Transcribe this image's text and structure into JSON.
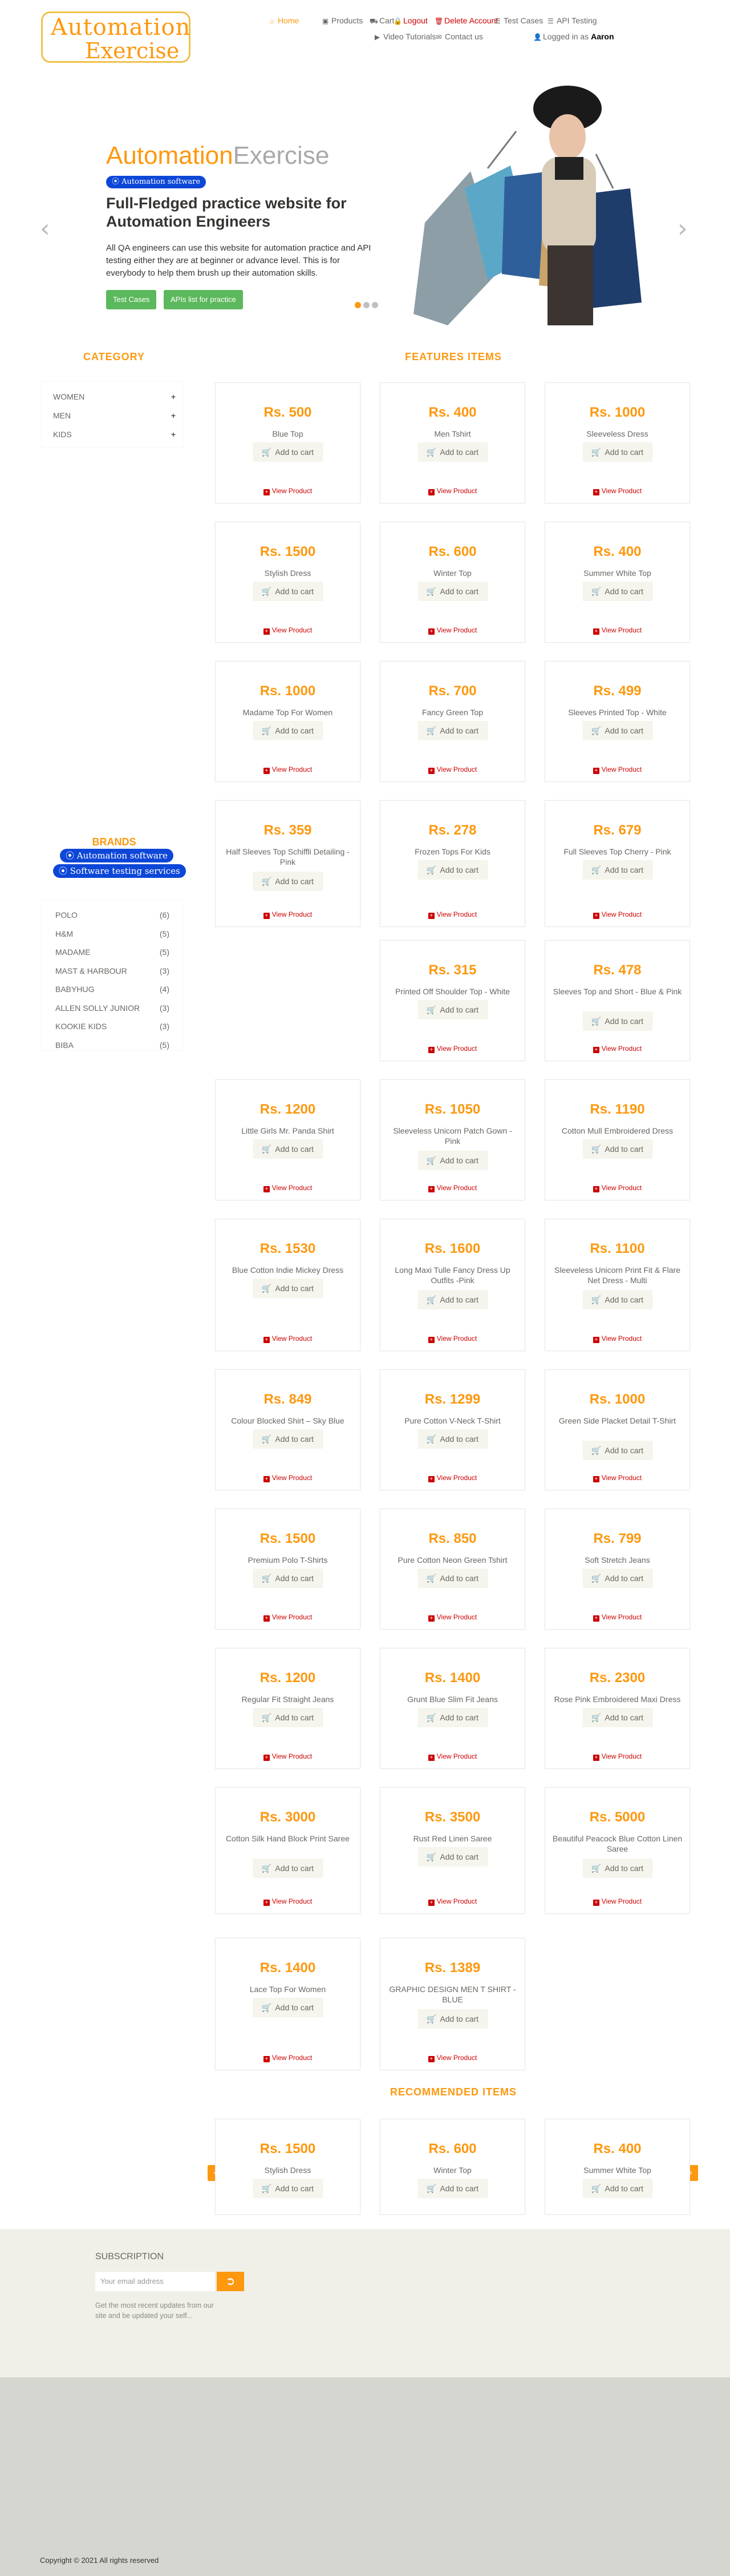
{
  "header": {
    "logo_line1_a": "Automation",
    "logo_line2_a": "Exercise",
    "nav": [
      {
        "label": "Home",
        "icon": "home-icon",
        "glyph": "⌂"
      },
      {
        "label": "Products",
        "icon": "products-icon",
        "glyph": "▣"
      },
      {
        "label": "Cart",
        "icon": "cart-icon",
        "glyph": "⛟"
      },
      {
        "label": "Logout",
        "icon": "lock-icon",
        "glyph": "🔒"
      },
      {
        "label": "Delete Account",
        "icon": "trash-icon",
        "glyph": "🗑"
      },
      {
        "label": "Test Cases",
        "icon": "list-icon",
        "glyph": "☰"
      },
      {
        "label": "API Testing",
        "icon": "list-icon",
        "glyph": "☰"
      },
      {
        "label": "Video Tutorials",
        "icon": "youtube-icon",
        "glyph": "▶"
      },
      {
        "label": "Contact us",
        "icon": "envelope-icon",
        "glyph": "✉"
      }
    ],
    "logged_in_prefix": "Logged in as",
    "logged_in_user": "Aaron"
  },
  "hero": {
    "title_a": "Automation",
    "title_b": "Exercise",
    "badge": "Automation software",
    "heading": "Full-Fledged practice website for Automation Engineers",
    "paragraph": "All QA engineers can use this website for automation practice and API testing either they are at beginner or advance level. This is for everybody to help them brush up their automation skills.",
    "btn_test_cases": "Test Cases",
    "btn_apis": "APIs list for practice"
  },
  "sidebar": {
    "category_title": "CATEGORY",
    "categories": [
      "Women",
      "Men",
      "Kids"
    ],
    "brands_title": "BRANDS",
    "brand_badges": [
      "Automation software",
      "Software testing services"
    ],
    "brands": [
      {
        "name": "Polo",
        "count": "(6)"
      },
      {
        "name": "H&M",
        "count": "(5)"
      },
      {
        "name": "Madame",
        "count": "(5)"
      },
      {
        "name": "Mast & Harbour",
        "count": "(3)"
      },
      {
        "name": "Babyhug",
        "count": "(4)"
      },
      {
        "name": "Allen Solly Junior",
        "count": "(3)"
      },
      {
        "name": "Kookie Kids",
        "count": "(3)"
      },
      {
        "name": "Biba",
        "count": "(5)"
      }
    ]
  },
  "features_title": "FEATURES ITEMS",
  "add_to_cart_label": "Add to cart",
  "view_product_label": "View Product",
  "products": [
    {
      "price": "Rs. 500",
      "name": "Blue Top"
    },
    {
      "price": "Rs. 400",
      "name": "Men Tshirt"
    },
    {
      "price": "Rs. 1000",
      "name": "Sleeveless Dress"
    },
    {
      "price": "Rs. 1500",
      "name": "Stylish Dress"
    },
    {
      "price": "Rs. 600",
      "name": "Winter Top"
    },
    {
      "price": "Rs. 400",
      "name": "Summer White Top"
    },
    {
      "price": "Rs. 1000",
      "name": "Madame Top For Women"
    },
    {
      "price": "Rs. 700",
      "name": "Fancy Green Top"
    },
    {
      "price": "Rs. 499",
      "name": "Sleeves Printed Top - White"
    },
    {
      "price": "Rs. 359",
      "name": "Half Sleeves Top Schiffli Detailing - Pink"
    },
    {
      "price": "Rs. 278",
      "name": "Frozen Tops For Kids"
    },
    {
      "price": "Rs. 679",
      "name": "Full Sleeves Top Cherry - Pink"
    },
    {
      "price": "Rs. 315",
      "name": "Printed Off Shoulder Top - White"
    },
    {
      "price": "Rs. 478",
      "name": "Sleeves Top and Short - Blue & Pink"
    },
    {
      "price": "Rs. 1200",
      "name": "Little Girls Mr. Panda Shirt"
    },
    {
      "price": "Rs. 1050",
      "name": "Sleeveless Unicorn Patch Gown - Pink"
    },
    {
      "price": "Rs. 1190",
      "name": "Cotton Mull Embroidered Dress"
    },
    {
      "price": "Rs. 1530",
      "name": "Blue Cotton Indie Mickey Dress"
    },
    {
      "price": "Rs. 1600",
      "name": "Long Maxi Tulle Fancy Dress Up Outfits -Pink"
    },
    {
      "price": "Rs. 1100",
      "name": "Sleeveless Unicorn Print Fit & Flare Net Dress - Multi"
    },
    {
      "price": "Rs. 849",
      "name": "Colour Blocked Shirt – Sky Blue"
    },
    {
      "price": "Rs. 1299",
      "name": "Pure Cotton V-Neck T-Shirt"
    },
    {
      "price": "Rs. 1000",
      "name": "Green Side Placket Detail T-Shirt"
    },
    {
      "price": "Rs. 1500",
      "name": "Premium Polo T-Shirts"
    },
    {
      "price": "Rs. 850",
      "name": "Pure Cotton Neon Green Tshirt"
    },
    {
      "price": "Rs. 799",
      "name": "Soft Stretch Jeans"
    },
    {
      "price": "Rs. 1200",
      "name": "Regular Fit Straight Jeans"
    },
    {
      "price": "Rs. 1400",
      "name": "Grunt Blue Slim Fit Jeans"
    },
    {
      "price": "Rs. 2300",
      "name": "Rose Pink Embroidered Maxi Dress"
    },
    {
      "price": "Rs. 3000",
      "name": "Cotton Silk Hand Block Print Saree"
    },
    {
      "price": "Rs. 3500",
      "name": "Rust Red Linen Saree"
    },
    {
      "price": "Rs. 5000",
      "name": "Beautiful Peacock Blue Cotton Linen Saree"
    },
    {
      "price": "Rs. 1400",
      "name": "Lace Top For Women"
    },
    {
      "price": "Rs. 1389",
      "name": "GRAPHIC DESIGN MEN T SHIRT - BLUE"
    }
  ],
  "recommended_title": "RECOMMENDED ITEMS",
  "recommended": [
    {
      "price": "Rs. 1500",
      "name": "Stylish Dress"
    },
    {
      "price": "Rs. 600",
      "name": "Winter Top"
    },
    {
      "price": "Rs. 400",
      "name": "Summer White Top"
    }
  ],
  "footer": {
    "subscription_title": "Subscription",
    "email_placeholder": "Your email address",
    "subscription_text": "Get the most recent updates from our site and be updated your self...",
    "copyright": "Copyright © 2021 All rights reserved"
  },
  "colors": {
    "accent": "#fe980f",
    "badge_blue": "#0d47d8",
    "green": "#5cb85c"
  }
}
